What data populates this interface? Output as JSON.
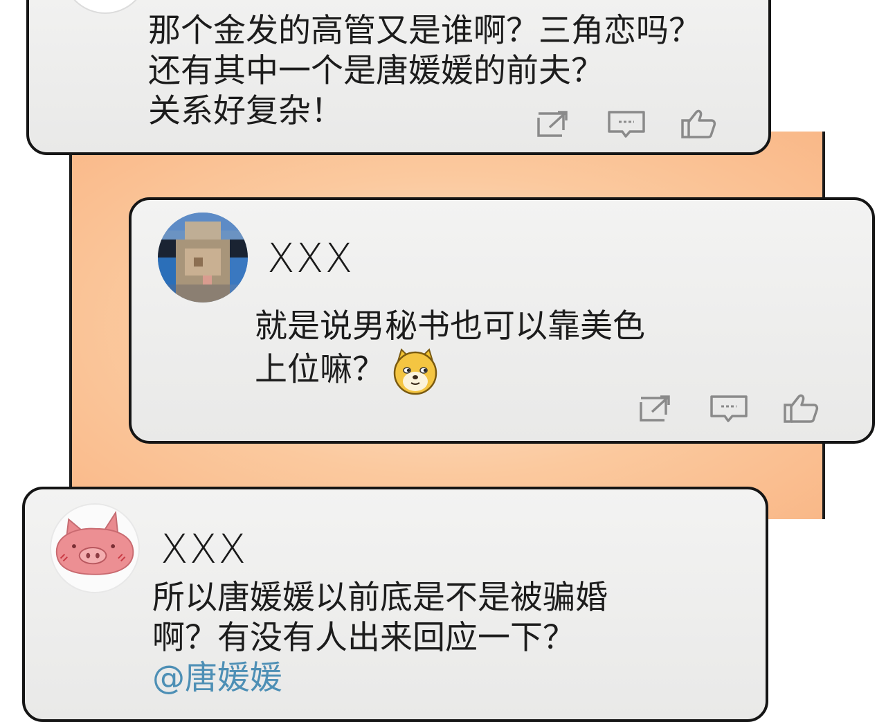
{
  "colors": {
    "card_bg": "#eeeeed",
    "outline": "#151515",
    "strip_bg": "#fbc99e",
    "mention": "#4d8fb5",
    "icon_gray": "#8a8a8a"
  },
  "comments": [
    {
      "username": "",
      "text": "那个金发的高管又是谁啊？三角恋吗？\n还有其中一个是唐媛媛的前夫？\n关系好复杂！",
      "actions": [
        "share-icon",
        "comment-icon",
        "like-icon"
      ]
    },
    {
      "username": "XXX",
      "avatar": "pixelated-avatar",
      "text": "就是说男秘书也可以靠美色\n上位嘛？",
      "emoji": "doge-emoji",
      "actions": [
        "share-icon",
        "comment-icon",
        "like-icon"
      ]
    },
    {
      "username": "XXX",
      "avatar": "pig-avatar",
      "text": "所以唐媛媛以前底是不是被骗婚\n啊？有没有人出来回应一下？",
      "mention": "@唐媛媛"
    }
  ]
}
